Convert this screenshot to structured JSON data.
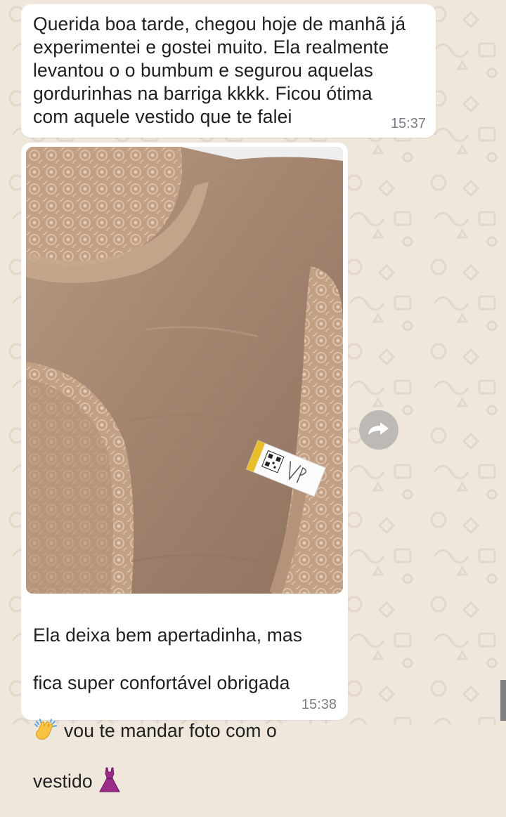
{
  "chat": {
    "messages": [
      {
        "text": "Querida boa tarde, chegou hoje de manhã já\nexperimentei e gostei muito. Ela realmente\nlevantou o o bumbum e segurou aquelas\ngordurinhas na barriga kkkk. Ficou ótima\ncom aquele vestido que te falei",
        "time": "15:37"
      },
      {
        "image_description_icon": "product-photo-lace-shapewear",
        "caption_line_1": "Ela deixa bem apertadinha, mas",
        "caption_line_2": "fica super confortável obrigada",
        "caption_line_3": "vou te mandar foto com o",
        "caption_line_4": "vestido",
        "emoji_1": "clapping-hands-emoji",
        "emoji_2": "dress-emoji",
        "time": "15:38"
      }
    ]
  },
  "actions": {
    "forward_icon": "forward-arrow-icon"
  },
  "colors": {
    "chat_background": "#efe7dc",
    "bubble_background": "#ffffff",
    "time_text": "#7b7f83",
    "message_text": "#1f1f1f",
    "forward_button": "#bdbab5"
  }
}
